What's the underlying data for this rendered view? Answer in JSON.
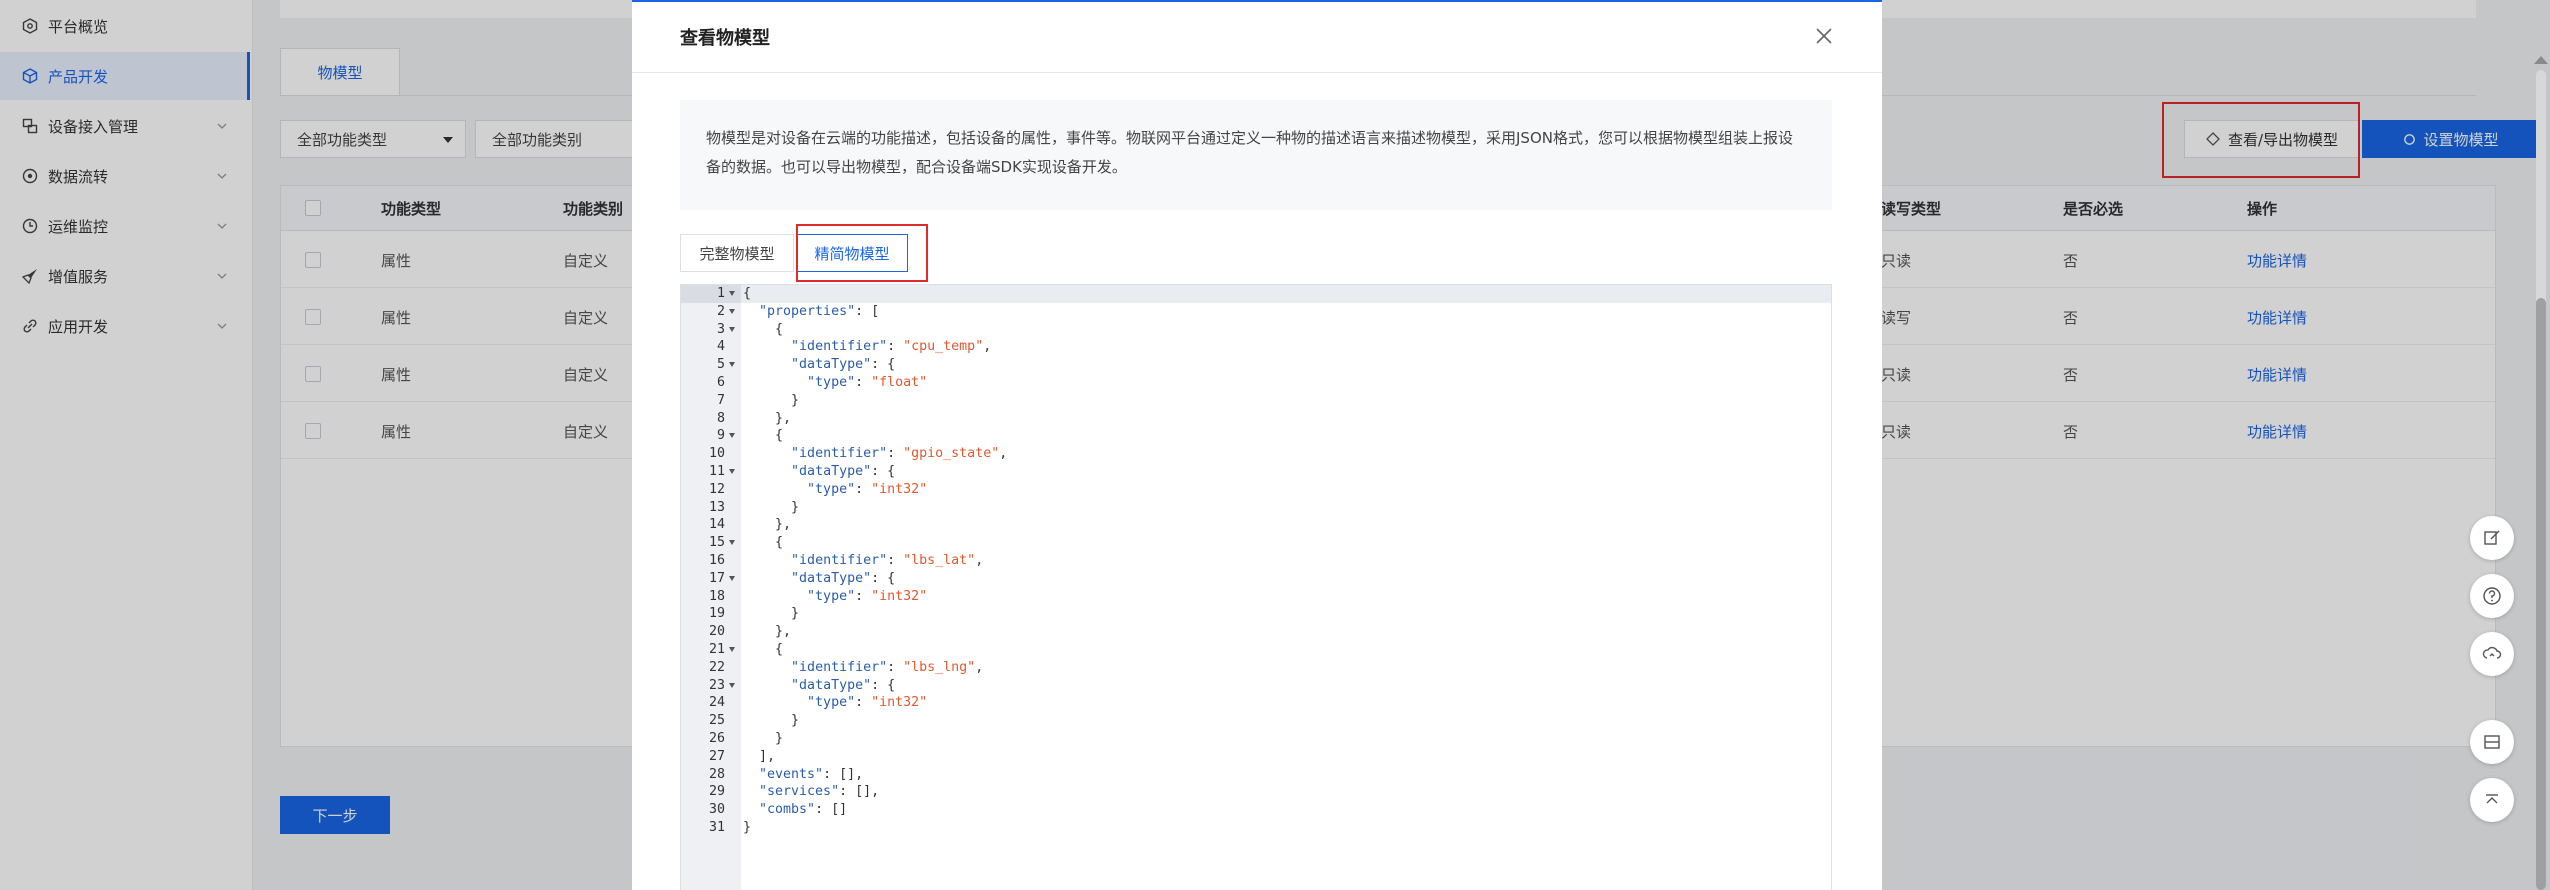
{
  "sidebar": {
    "items": [
      {
        "label": "平台概览",
        "icon": "dashboard-icon",
        "has_children": false
      },
      {
        "label": "产品开发",
        "icon": "cube-icon",
        "has_children": false,
        "active": true
      },
      {
        "label": "设备接入管理",
        "icon": "device-icon",
        "has_children": true
      },
      {
        "label": "数据流转",
        "icon": "data-flow-icon",
        "has_children": true
      },
      {
        "label": "运维监控",
        "icon": "monitor-icon",
        "has_children": true
      },
      {
        "label": "增值服务",
        "icon": "rocket-icon",
        "has_children": true
      },
      {
        "label": "应用开发",
        "icon": "link-icon",
        "has_children": true
      }
    ]
  },
  "main": {
    "tab_label": "物模型",
    "filter_type": "全部功能类型",
    "filter_category": "全部功能类别",
    "export_button": "查看/导出物模型",
    "setting_button": "设置物模型",
    "columns": {
      "type": "功能类型",
      "category": "功能类别",
      "rw": "读写类型",
      "required": "是否必选",
      "action": "操作"
    },
    "rows": [
      {
        "type": "属性",
        "category": "自定义",
        "rw": "只读",
        "required": "否",
        "action": "功能详情"
      },
      {
        "type": "属性",
        "category": "自定义",
        "rw": "读写",
        "required": "否",
        "action": "功能详情"
      },
      {
        "type": "属性",
        "category": "自定义",
        "rw": "只读",
        "required": "否",
        "action": "功能详情"
      },
      {
        "type": "属性",
        "category": "自定义",
        "rw": "只读",
        "required": "否",
        "action": "功能详情"
      }
    ],
    "next_button": "下一步"
  },
  "modal": {
    "title": "查看物模型",
    "desc_line1": "物模型是对设备在云端的功能描述，包括设备的属性，事件等。物联网平台通过定义一种物的描述语言来描述物模型，采用JSON格式，您可以根据物模型组装上报设",
    "desc_line2": "备的数据。也可以导出物模型，配合设备端SDK实现设备开发。",
    "tab_full": "完整物模型",
    "tab_simple": "精简物模型"
  },
  "colors": {
    "primary": "#1a66e6",
    "highlight_box": "#e02b2b",
    "json_key": "#2b5da8",
    "json_string": "#e05a30"
  }
}
